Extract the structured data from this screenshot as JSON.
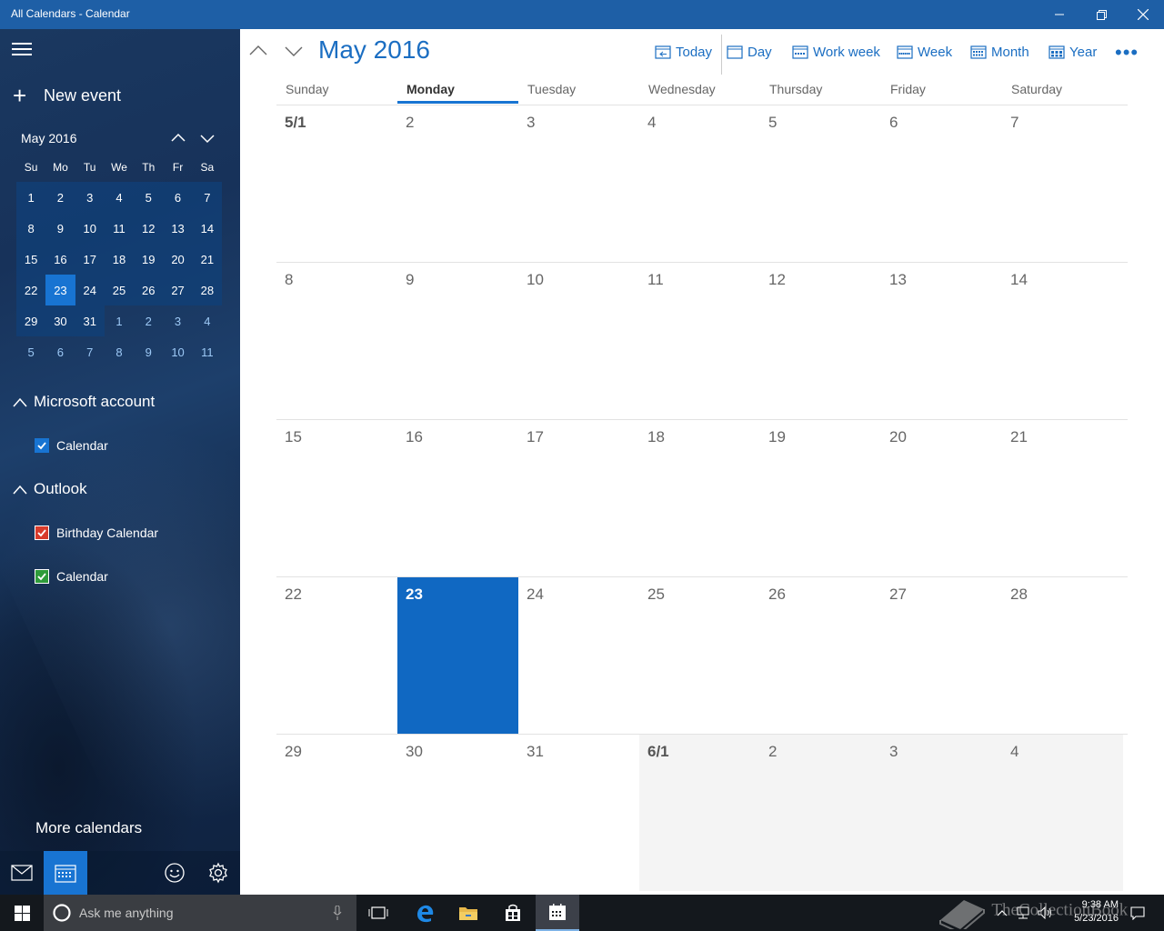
{
  "window": {
    "title": "All Calendars - Calendar"
  },
  "sidebar": {
    "new_event_label": "New event",
    "mini_calendar": {
      "month_label": "May 2016",
      "dow": [
        "Su",
        "Mo",
        "Tu",
        "We",
        "Th",
        "Fr",
        "Sa"
      ],
      "weeks": [
        [
          "1",
          "2",
          "3",
          "4",
          "5",
          "6",
          "7"
        ],
        [
          "8",
          "9",
          "10",
          "11",
          "12",
          "13",
          "14"
        ],
        [
          "15",
          "16",
          "17",
          "18",
          "19",
          "20",
          "21"
        ],
        [
          "22",
          "23",
          "24",
          "25",
          "26",
          "27",
          "28"
        ],
        [
          "29",
          "30",
          "31",
          "1",
          "2",
          "3",
          "4"
        ],
        [
          "5",
          "6",
          "7",
          "8",
          "9",
          "10",
          "11"
        ]
      ],
      "selected": "23"
    },
    "accounts": [
      {
        "name": "Microsoft account",
        "calendars": [
          {
            "name": "Calendar",
            "color": "#1874d2",
            "checked": true
          }
        ]
      },
      {
        "name": "Outlook",
        "calendars": [
          {
            "name": "Birthday Calendar",
            "color": "#d83b2b",
            "checked": true
          },
          {
            "name": "Calendar",
            "color": "#2e9b3a",
            "checked": true
          }
        ]
      }
    ],
    "more_calendars_label": "More calendars"
  },
  "header": {
    "month_title": "May 2016",
    "toolbar": {
      "today": "Today",
      "day": "Day",
      "work_week": "Work week",
      "week": "Week",
      "month": "Month",
      "year": "Year",
      "more": "•••"
    }
  },
  "month_view": {
    "day_headers": [
      "Sunday",
      "Monday",
      "Tuesday",
      "Wednesday",
      "Thursday",
      "Friday",
      "Saturday"
    ],
    "today_header": "Monday",
    "weeks": [
      [
        "5/1",
        "2",
        "3",
        "4",
        "5",
        "6",
        "7"
      ],
      [
        "8",
        "9",
        "10",
        "11",
        "12",
        "13",
        "14"
      ],
      [
        "15",
        "16",
        "17",
        "18",
        "19",
        "20",
        "21"
      ],
      [
        "22",
        "23",
        "24",
        "25",
        "26",
        "27",
        "28"
      ],
      [
        "29",
        "30",
        "31",
        "6/1",
        "2",
        "3",
        "4"
      ]
    ],
    "today_date": "23",
    "accent_color": "#1068c2"
  },
  "taskbar": {
    "search_placeholder": "Ask me anything",
    "time": "9:38 AM",
    "date": "5/23/2016",
    "watermark": "TheCollectionBook"
  }
}
